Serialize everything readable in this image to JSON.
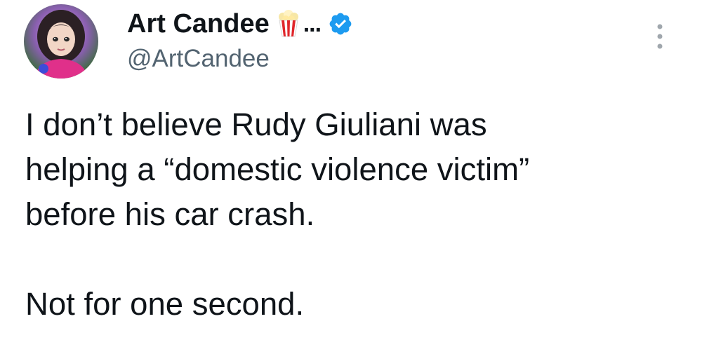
{
  "author": {
    "display_name": "Art Candee",
    "name_suffix": "...",
    "handle": "@ArtCandee",
    "name_emoji_icon": "popcorn-icon",
    "verified_icon": "verified-badge-icon",
    "verified_color": "#1d9bf0"
  },
  "menu": {
    "icon": "more-options-icon"
  },
  "tweet": {
    "paragraph_1": "I don’t believe Rudy Giuliani was\nhelping a “domestic violence victim”\nbefore his car crash.",
    "paragraph_2": "Not for one second."
  },
  "colors": {
    "text": "#0f1419",
    "secondary_text": "#536471",
    "accent": "#1d9bf0"
  }
}
